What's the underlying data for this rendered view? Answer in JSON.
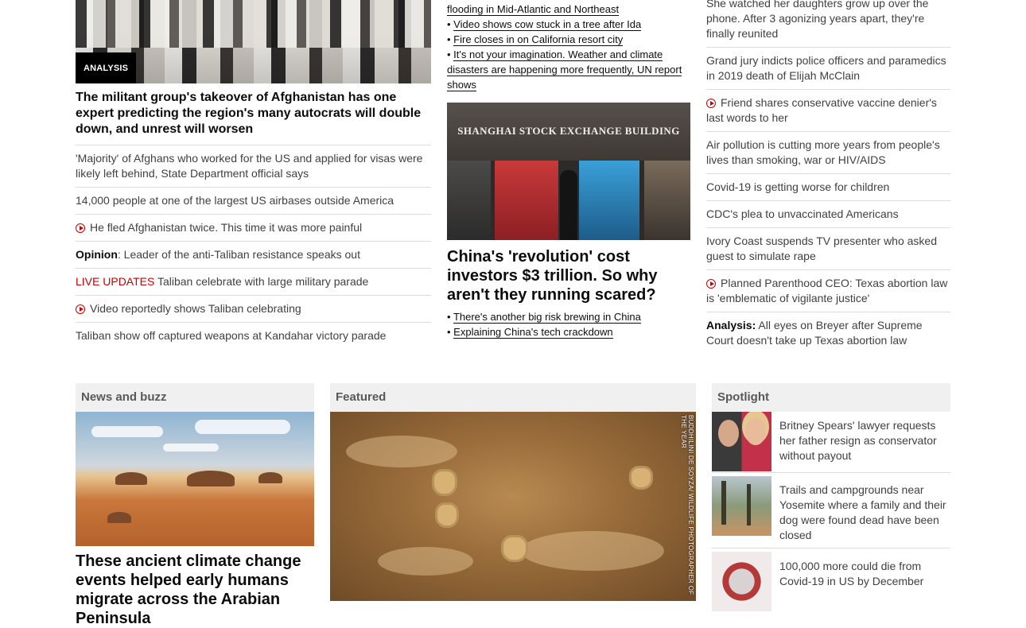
{
  "col1": {
    "badge": "ANALYSIS",
    "headline": "The militant group's takeover of Afghanistan has one expert predicting the region's many autocrats will double down, and unrest will worsen",
    "items": [
      {
        "text": "'Majority' of Afghans who worked for the US and applied for visas were likely left behind, State Department official says"
      },
      {
        "text": "14,000 people at one of the largest US airbases outside America"
      },
      {
        "text": "He fled Afghanistan twice. This time it was more painful",
        "video": true
      },
      {
        "prefix": "Opinion",
        "text": ": Leader of the anti-Taliban resistance speaks out"
      },
      {
        "prefix_red": "LIVE UPDATES",
        "text": " Taliban celebrate with large military parade"
      },
      {
        "text": "Video reportedly shows Taliban celebrating",
        "video": true
      },
      {
        "text": "Taliban show off captured weapons at Kandahar victory parade"
      }
    ]
  },
  "col2": {
    "top_links": [
      "flooding in Mid-Atlantic and Northeast",
      "Video shows cow stuck in a tree after Ida",
      "Fire closes in on California resort city",
      "It's not your imagination. Weather and climate disasters are happening more frequently, UN report shows"
    ],
    "image_sign": "SHANGHAI STOCK EXCHANGE BUILDING",
    "headline": "China's 'revolution' cost investors $3 trillion. So why aren't they running scared?",
    "links": [
      "There's another big risk brewing in China",
      "Explaining China's tech crackdown"
    ]
  },
  "col3": {
    "items": [
      {
        "text": "She watched her daughters grow up over the phone. After 3 agonizing years apart, they're finally reunited"
      },
      {
        "text": "Grand jury indicts police officers and paramedics in 2019 death of Elijah McClain"
      },
      {
        "text": "Friend shares conservative vaccine denier's last words to her",
        "video": true
      },
      {
        "text": "Air pollution is cutting more years from people's lives than smoking, war or HIV/AIDS"
      },
      {
        "text": "Covid-19 is getting worse for children"
      },
      {
        "text": "CDC's plea to unvaccinated Americans"
      },
      {
        "text": "Ivory Coast suspends TV presenter who asked guest to simulate rape"
      },
      {
        "text": "Planned Parenthood CEO: Texas abortion law is 'emblematic of vigilante justice'",
        "video": true
      },
      {
        "prefix": "Analysis:",
        "text": " All eyes on Breyer after Supreme Court doesn't take up Texas abortion law"
      }
    ]
  },
  "sections": {
    "news_buzz": "News and buzz",
    "featured": "Featured",
    "spotlight": "Spotlight"
  },
  "news_buzz": {
    "headline": "These ancient climate change events helped early humans migrate across the Arabian Peninsula"
  },
  "featured": {
    "credit": "BUDDHILINI DE SOYZA/ WILDLIFE PHOTOGRAPHER OF THE YEAR"
  },
  "spotlight": [
    {
      "text": "Britney Spears' lawyer requests her father resign as conservator without payout"
    },
    {
      "text": "Trails and campgrounds near Yosemite where a family and their dog were found dead have been closed"
    },
    {
      "text": "100,000 more could die from Covid-19 in US by December"
    }
  ]
}
